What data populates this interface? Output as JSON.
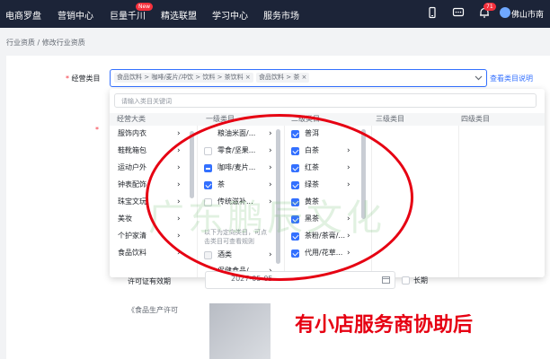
{
  "topnav": {
    "items": [
      "电商罗盘",
      "营销中心",
      "巨量千川",
      "精选联盟",
      "学习中心",
      "服务市场"
    ],
    "new_badge": "New",
    "notification_count": "71",
    "user": "佛山市南"
  },
  "breadcrumb": "行业资质 / 修改行业资质",
  "form": {
    "category_label": "经营类目",
    "selected_tags": [
      "食品饮料 > 咖啡/麦片/冲饮 > 饮料 > 茶饮料",
      "食品饮料 > 茶"
    ],
    "help_link": "查看类目说明",
    "validity_label": "许可证有效期",
    "validity_date": "2027-05-05",
    "longterm_label": "长期",
    "food_license_label": "《食品生产许可"
  },
  "dropdown": {
    "search_placeholder": "请输入类目关键词",
    "columns": [
      "经营大类",
      "一级类目",
      "二级类目",
      "三级类目",
      "四级类目"
    ],
    "level0": [
      "服饰内衣",
      "鞋靴箱包",
      "运动户外",
      "钟表配饰",
      "珠宝文玩",
      "美妆",
      "个护家清",
      "食品饮料"
    ],
    "level1": [
      {
        "label": "粮油米面/...",
        "state": "none"
      },
      {
        "label": "零食/坚果...",
        "state": "off"
      },
      {
        "label": "咖啡/麦片...",
        "state": "half"
      },
      {
        "label": "茶",
        "state": "on"
      },
      {
        "label": "传统滋补...",
        "state": "off"
      }
    ],
    "level1_hint": "以下为定向类目，可点击类目可查看规则",
    "level1_extra": [
      {
        "label": "酒类",
        "state": "off"
      },
      {
        "label": "保健食品/...",
        "state": "none"
      }
    ],
    "level2": [
      {
        "label": "普洱",
        "chev": false
      },
      {
        "label": "白茶",
        "chev": true
      },
      {
        "label": "红茶",
        "chev": true
      },
      {
        "label": "绿茶",
        "chev": true
      },
      {
        "label": "黄茶",
        "chev": false
      },
      {
        "label": "黑茶",
        "chev": true
      },
      {
        "label": "茶粉/茶膏/...",
        "chev": true
      },
      {
        "label": "代用/花草...",
        "chev": true
      }
    ]
  },
  "overlay": {
    "watermark": "广东鹏辰文化",
    "caption": "有小店服务商协助后"
  },
  "colors": {
    "accent": "#3370ff",
    "topbar": "#1c2438",
    "annotation": "#e60012"
  }
}
